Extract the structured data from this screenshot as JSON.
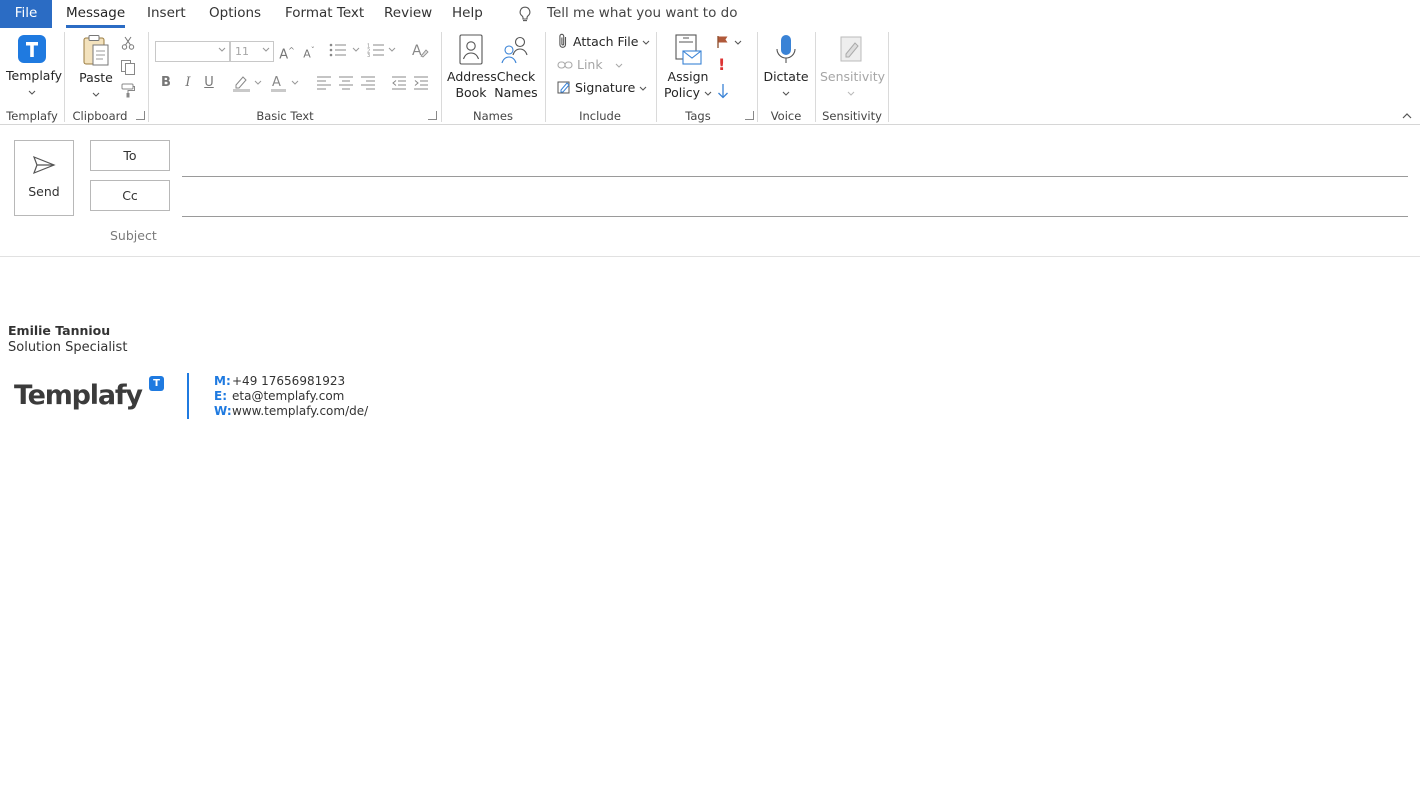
{
  "tabs": {
    "file": "File",
    "message": "Message",
    "insert": "Insert",
    "options": "Options",
    "format_text": "Format Text",
    "review": "Review",
    "help": "Help",
    "tell_me": "Tell me what you want to do"
  },
  "ribbon": {
    "templafy": {
      "button": "Templafy",
      "group": "Templafy"
    },
    "clipboard": {
      "paste": "Paste",
      "group": "Clipboard"
    },
    "basic_text": {
      "font_name": "",
      "font_size": "11",
      "bold": "B",
      "italic": "I",
      "underline": "U",
      "group": "Basic Text"
    },
    "names": {
      "address_book_1": "Address",
      "address_book_2": "Book",
      "check_names_1": "Check",
      "check_names_2": "Names",
      "group": "Names"
    },
    "include": {
      "attach_file": "Attach File",
      "link": "Link",
      "signature": "Signature",
      "group": "Include"
    },
    "tags": {
      "assign_policy_1": "Assign",
      "assign_policy_2": "Policy",
      "high_importance": "!",
      "group": "Tags"
    },
    "voice": {
      "dictate": "Dictate",
      "group": "Voice"
    },
    "sensitivity": {
      "button": "Sensitivity",
      "group": "Sensitivity"
    }
  },
  "compose": {
    "send": "Send",
    "to": "To",
    "cc": "Cc",
    "subject": "Subject",
    "to_value": "",
    "cc_value": "",
    "subject_value": ""
  },
  "signature": {
    "name": "Emilie Tanniou",
    "title": "Solution Specialist",
    "logo_text": "Templafy",
    "logo_badge": "T",
    "mobile_label": "M:",
    "mobile": "+49 17656981923",
    "email_label": "E:",
    "email": "eta@templafy.com",
    "web_label": "W:",
    "web": "www.templafy.com/de/"
  },
  "colors": {
    "accent": "#2b6cc4",
    "brand": "#1f7ae0"
  }
}
